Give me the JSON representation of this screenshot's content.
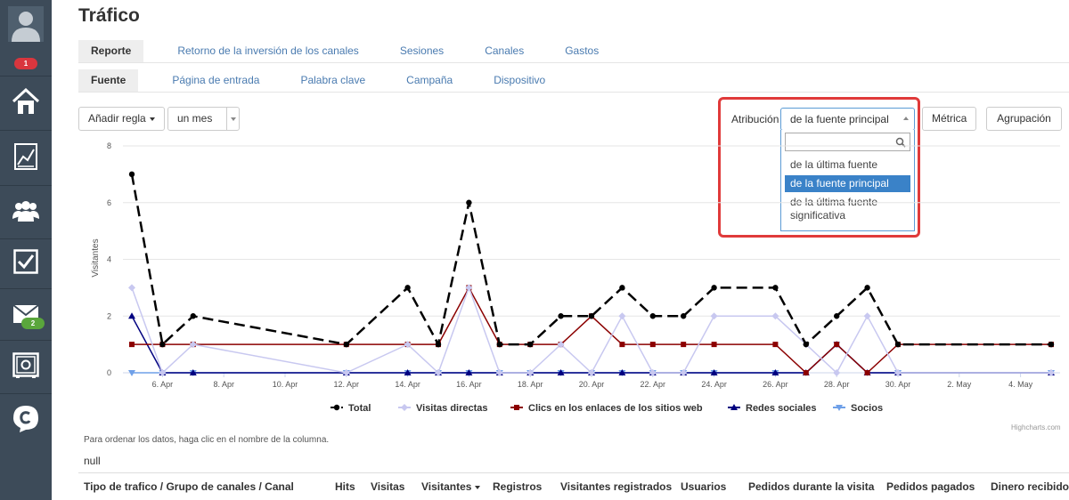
{
  "sidebar": {
    "notifications_badge": "1",
    "mail_badge": "2",
    "items": [
      {
        "icon": "user-avatar-icon"
      },
      {
        "icon": "home-icon"
      },
      {
        "icon": "analytics-chart-icon"
      },
      {
        "icon": "contacts-group-icon"
      },
      {
        "icon": "tasks-checkbox-icon"
      },
      {
        "icon": "mail-icon"
      },
      {
        "icon": "safe-icon"
      },
      {
        "icon": "chat-logo-icon"
      }
    ],
    "colors": {
      "background": "#3d4b59",
      "badge_red": "#d9363e",
      "badge_green": "#5aa63c"
    }
  },
  "page_title": "Tráfico",
  "tabs_primary": [
    {
      "label": "Reporte",
      "active": true
    },
    {
      "label": "Retorno de la inversión de los canales",
      "active": false
    },
    {
      "label": "Sesiones",
      "active": false
    },
    {
      "label": "Canales",
      "active": false
    },
    {
      "label": "Gastos",
      "active": false
    }
  ],
  "tabs_secondary": [
    {
      "label": "Fuente",
      "active": true
    },
    {
      "label": "Página de entrada",
      "active": false
    },
    {
      "label": "Palabra clave",
      "active": false
    },
    {
      "label": "Campaña",
      "active": false
    },
    {
      "label": "Dispositivo",
      "active": false
    }
  ],
  "toolbar": {
    "add_rule": "Añadir regla",
    "period": "un mes",
    "attribution_label": "Atribución",
    "attribution_value": "de la fuente principal",
    "metric": "Métrica",
    "grouping": "Agrupación"
  },
  "attribution_dropdown": {
    "search_value": "",
    "options": [
      {
        "label": "de la última fuente",
        "selected": false
      },
      {
        "label": "de la fuente principal",
        "selected": true
      },
      {
        "label": "de la última fuente significativa",
        "selected": false
      }
    ]
  },
  "chart_data": {
    "type": "line",
    "ylabel": "Visitantes",
    "ylim": [
      0,
      8
    ],
    "yticks": [
      0,
      2,
      4,
      6,
      8
    ],
    "x": [
      "5. Apr",
      "6. Apr",
      "7. Apr",
      "12. Apr",
      "14. Apr",
      "15. Apr",
      "16. Apr",
      "17. Apr",
      "18. Apr",
      "19. Apr",
      "20. Apr",
      "21. Apr",
      "22. Apr",
      "23. Apr",
      "24. Apr",
      "26. Apr",
      "27. Apr",
      "28. Apr",
      "29. Apr",
      "30. Apr",
      "5. May"
    ],
    "xticks": [
      "6. Apr",
      "8. Apr",
      "10. Apr",
      "12. Apr",
      "14. Apr",
      "16. Apr",
      "18. Apr",
      "20. Apr",
      "22. Apr",
      "24. Apr",
      "26. Apr",
      "28. Apr",
      "30. Apr",
      "2. May",
      "4. May"
    ],
    "series": [
      {
        "name": "Total",
        "color": "#000000",
        "dash": true,
        "marker": "circle",
        "values": [
          7,
          1,
          2,
          1,
          3,
          1,
          6,
          1,
          1,
          2,
          2,
          3,
          2,
          2,
          3,
          3,
          1,
          2,
          3,
          1,
          1
        ]
      },
      {
        "name": "Visitas directas",
        "color": "#c8c8f0",
        "dash": false,
        "marker": "diamond",
        "values": [
          3,
          0,
          1,
          0,
          1,
          0,
          3,
          0,
          0,
          1,
          0,
          2,
          0,
          0,
          2,
          2,
          1,
          0,
          2,
          0,
          0
        ]
      },
      {
        "name": "Clics en los enlaces de los sitios web",
        "color": "#8b0000",
        "dash": false,
        "marker": "square",
        "values": [
          1,
          1,
          1,
          1,
          1,
          1,
          3,
          1,
          1,
          1,
          2,
          1,
          1,
          1,
          1,
          1,
          0,
          1,
          0,
          1,
          1
        ]
      },
      {
        "name": "Redes sociales",
        "color": "#000080",
        "dash": false,
        "marker": "triangle",
        "values": [
          2,
          0,
          0,
          0,
          0,
          0,
          0,
          0,
          0,
          0,
          0,
          0,
          0,
          0,
          0,
          0,
          0,
          1,
          0,
          0,
          0
        ]
      },
      {
        "name": "Socios",
        "color": "#6fa0e8",
        "dash": false,
        "marker": "triangle-down",
        "values": [
          0,
          0,
          0,
          0,
          0,
          0,
          0,
          0,
          0,
          0,
          0,
          0,
          0,
          0,
          0,
          0,
          0,
          1,
          0,
          0,
          0
        ]
      }
    ],
    "legend_position": "bottom",
    "credits": "Highcharts.com"
  },
  "note": "Para ordenar los datos, haga clic en el nombre de la columna.",
  "null_text": "null",
  "table_headers": [
    "Tipo de trafico / Grupo de canales / Canal",
    "Hits",
    "Visitas",
    "Visitantes",
    "Registros",
    "Visitantes registrados",
    "Usuarios",
    "Pedidos durante la visita",
    "Pedidos pagados",
    "Dinero recibido"
  ]
}
